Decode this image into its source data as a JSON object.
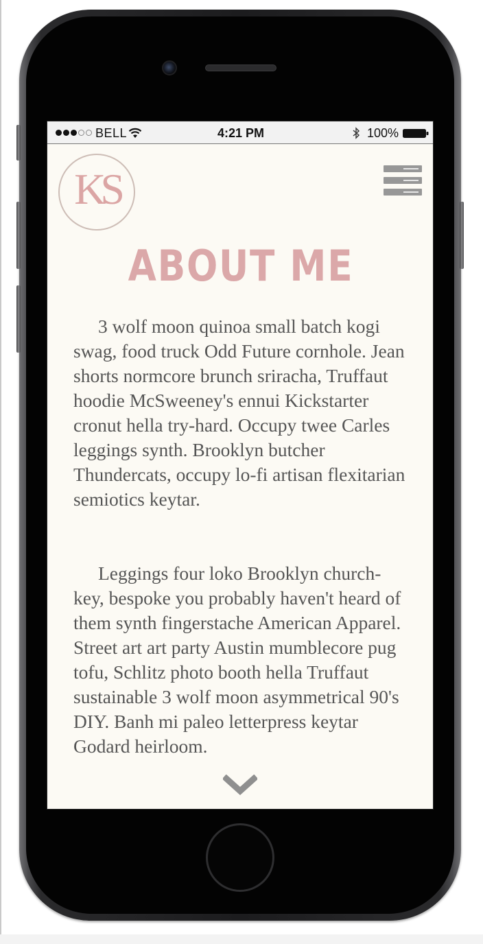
{
  "status_bar": {
    "carrier": "BELL",
    "time": "4:21 PM",
    "battery": "100%"
  },
  "header": {
    "logo_text": "KS",
    "menu_icon": "hamburger-menu-icon"
  },
  "page": {
    "title": "ABOUT ME",
    "paragraphs": [
      "3 wolf moon quinoa small batch kogi swag, food truck Odd Future cornhole. Jean shorts normcore brunch sriracha, Truffaut hoodie McSweeney's ennui Kickstarter cronut hella try-hard. Occupy twee Carles leggings synth. Brooklyn butcher Thundercats, occupy lo-fi artisan flexitarian semiotics keytar.",
      "Leggings four loko Brooklyn church-key, bespoke you probably haven't heard of them synth fingerstache American Apparel. Street art art party Austin mumblecore pug tofu, Schlitz photo booth hella Truffaut sustainable 3 wolf moon asymmetrical 90's DIY. Banh mi paleo letterpress keytar Godard heirloom."
    ]
  },
  "colors": {
    "accent_pink": "#dba8a9",
    "screen_background": "#fcfaf4",
    "body_text": "#555555",
    "menu_gray": "#979797"
  },
  "icons": {
    "scroll": "chevron-down-icon",
    "wifi": "wifi-icon",
    "bluetooth": "bluetooth-icon",
    "battery": "battery-icon"
  }
}
